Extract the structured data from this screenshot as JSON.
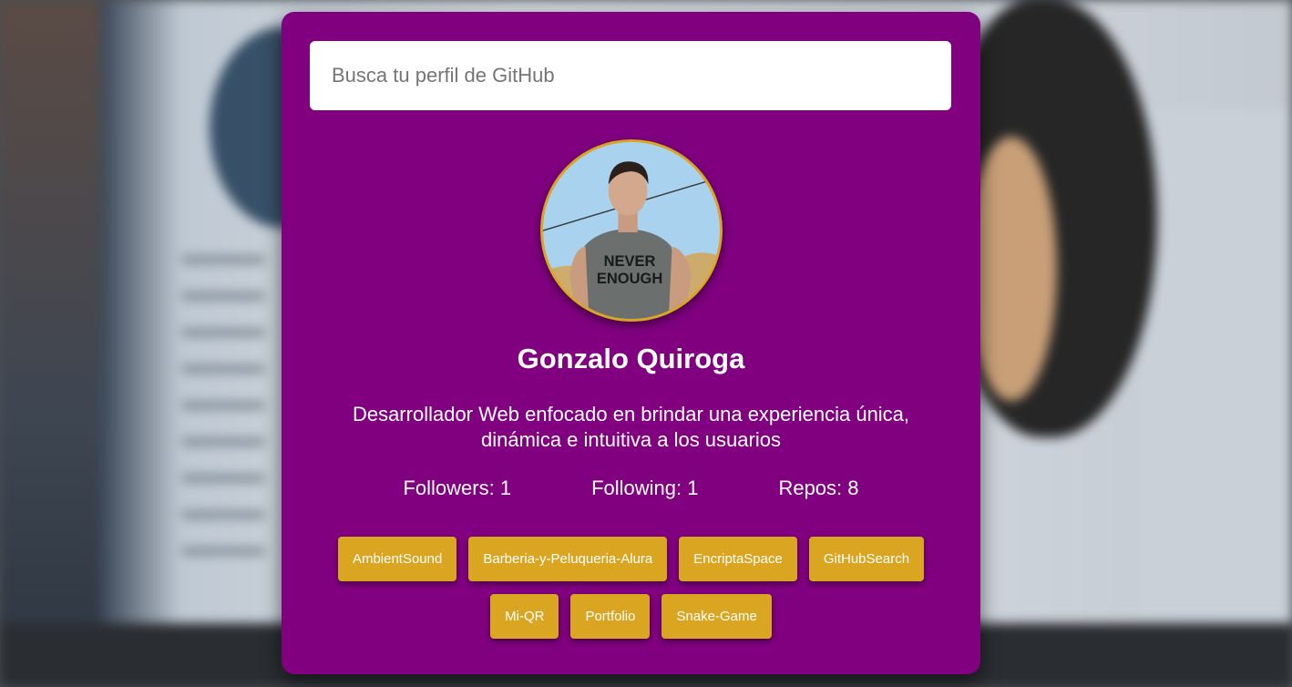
{
  "search": {
    "placeholder": "Busca tu perfil de GitHub",
    "value": ""
  },
  "profile": {
    "name": "Gonzalo Quiroga",
    "bio": "Desarrollador Web enfocado en brindar una experiencia única, dinámica e intuitiva a los usuarios",
    "avatar_shirt_text": [
      "NEVER",
      "ENOUGH"
    ]
  },
  "stats": {
    "followers": "Followers: 1",
    "following": "Following: 1",
    "repos": "Repos: 8"
  },
  "repos": [
    "AmbientSound",
    "Barberia-y-Peluqueria-Alura",
    "EncriptaSpace",
    "GitHubSearch",
    "Mi-QR",
    "Portfolio",
    "Snake-Game"
  ],
  "colors": {
    "card": "#800080",
    "accent": "#daa520",
    "text": "#ffffff"
  }
}
